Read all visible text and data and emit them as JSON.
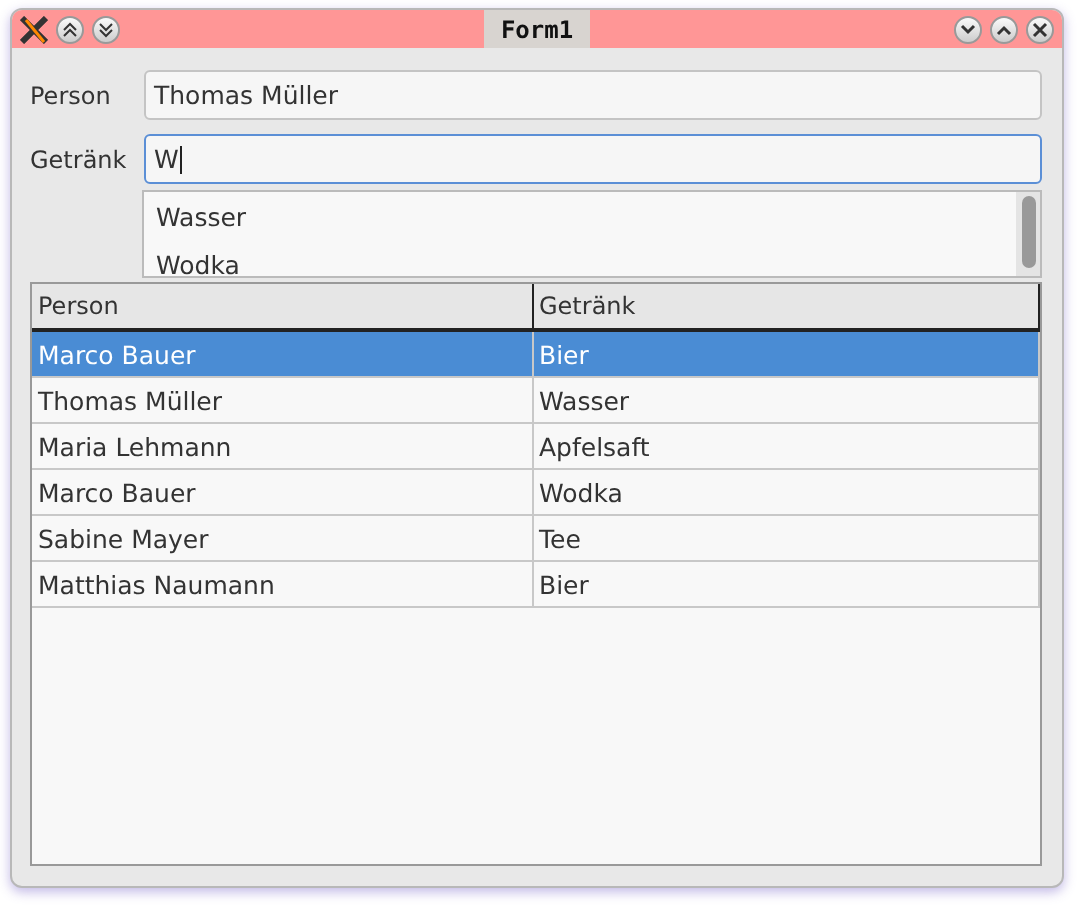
{
  "window": {
    "title": "Form1"
  },
  "fields": [
    {
      "label": "Person",
      "value": "Thomas Müller",
      "focused": false
    },
    {
      "label": "Getränk",
      "value": "W",
      "focused": true
    }
  ],
  "suggestions": [
    "Wasser",
    "Wodka"
  ],
  "table": {
    "columns": [
      "Person",
      "Getränk"
    ],
    "rows": [
      {
        "cells": [
          "Marco Bauer",
          "Bier"
        ],
        "selected": true
      },
      {
        "cells": [
          "Thomas Müller",
          "Wasser"
        ],
        "selected": false
      },
      {
        "cells": [
          "Maria Lehmann",
          "Apfelsaft"
        ],
        "selected": false
      },
      {
        "cells": [
          "Marco Bauer",
          "Wodka"
        ],
        "selected": false
      },
      {
        "cells": [
          "Sabine Mayer",
          "Tee"
        ],
        "selected": false
      },
      {
        "cells": [
          "Matthias Naumann",
          "Bier"
        ],
        "selected": false
      }
    ]
  }
}
